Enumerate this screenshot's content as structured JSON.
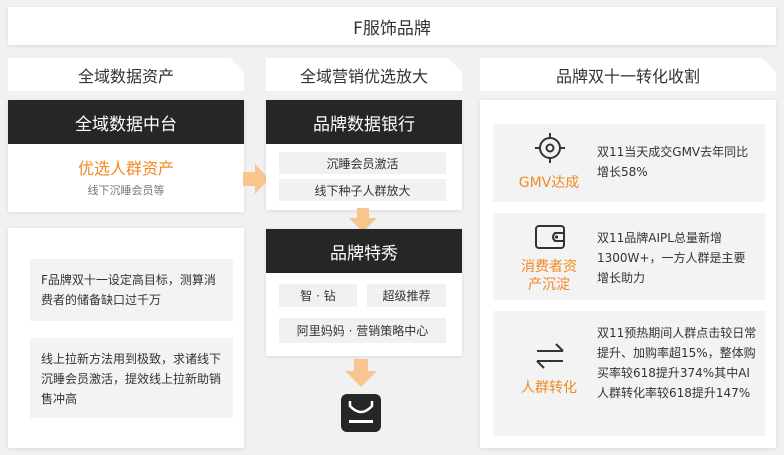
{
  "header": {
    "title": "F服饰品牌"
  },
  "columns": {
    "left": {
      "heading": "全域数据资产",
      "platform": "全域数据中台",
      "asset_title": "优选人群资产",
      "asset_sub": "线下沉睡会员等",
      "notes": [
        "F品牌双十一设定高目标，测算消费者的储备缺口过千万",
        "线上拉新方法用到极致，求诸线下沉睡会员激活，提效线上拉新助销售冲高"
      ]
    },
    "middle": {
      "heading": "全域营销优选放大",
      "bank": "品牌数据银行",
      "bank_items": [
        "沉睡会员激活",
        "线下种子人群放大"
      ],
      "show": "品牌特秀",
      "show_items": [
        "智 · 钻",
        "超级推荐",
        "阿里妈妈 · 营销策略中心"
      ]
    },
    "right": {
      "heading": "品牌双十一转化收割",
      "results": [
        {
          "label": "GMV达成",
          "icon": "target-icon",
          "text": "双11当天成交GMV去年同比增长58%"
        },
        {
          "label": "消费者资产沉淀",
          "icon": "wallet-icon",
          "text": "双11品牌AIPL总量新增1300W+，一方人群是主要增长助力"
        },
        {
          "label": "人群转化",
          "icon": "exchange-icon",
          "text": "双11预热期间人群点击较日常提升、加购率超15%，整体购买率较618提升374%其中AI人群转化率较618提升147%"
        }
      ]
    }
  },
  "colors": {
    "accent": "#f08a22",
    "arrow": "#f8c58e",
    "dark": "#262626",
    "panel": "#f3f3f3"
  }
}
